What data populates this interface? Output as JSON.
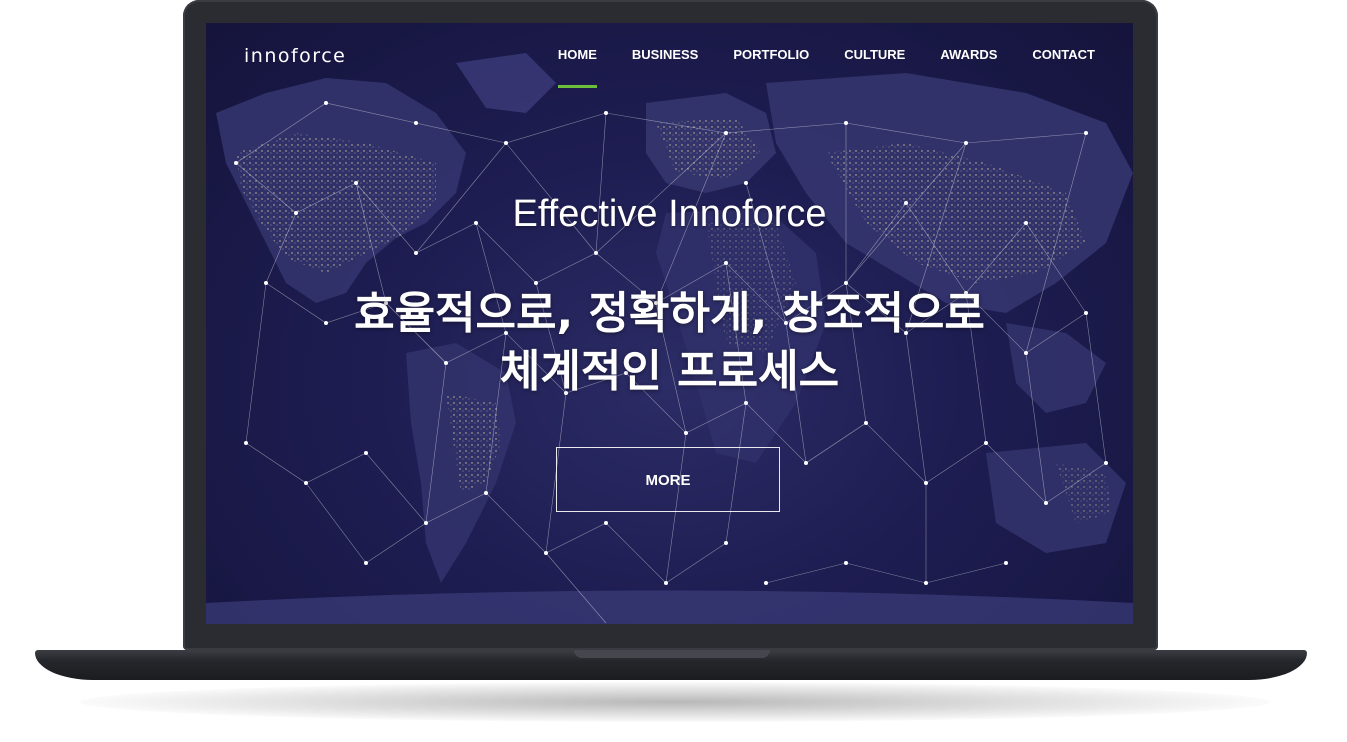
{
  "header": {
    "logo": "innoforce",
    "nav": [
      {
        "label": "HOME",
        "active": true
      },
      {
        "label": "BUSINESS",
        "active": false
      },
      {
        "label": "PORTFOLIO",
        "active": false
      },
      {
        "label": "CULTURE",
        "active": false
      },
      {
        "label": "AWARDS",
        "active": false
      },
      {
        "label": "CONTACT",
        "active": false
      }
    ]
  },
  "hero": {
    "subtitle": "Effective Innoforce",
    "title_line1": "효율적으로, 정확하게, 창조적으로",
    "title_line2": "체계적인 프로세스",
    "cta_label": "MORE"
  },
  "colors": {
    "background": "#1e1d52",
    "accent": "#6cbf3a",
    "text": "#ffffff",
    "device": "#2b2c31"
  }
}
